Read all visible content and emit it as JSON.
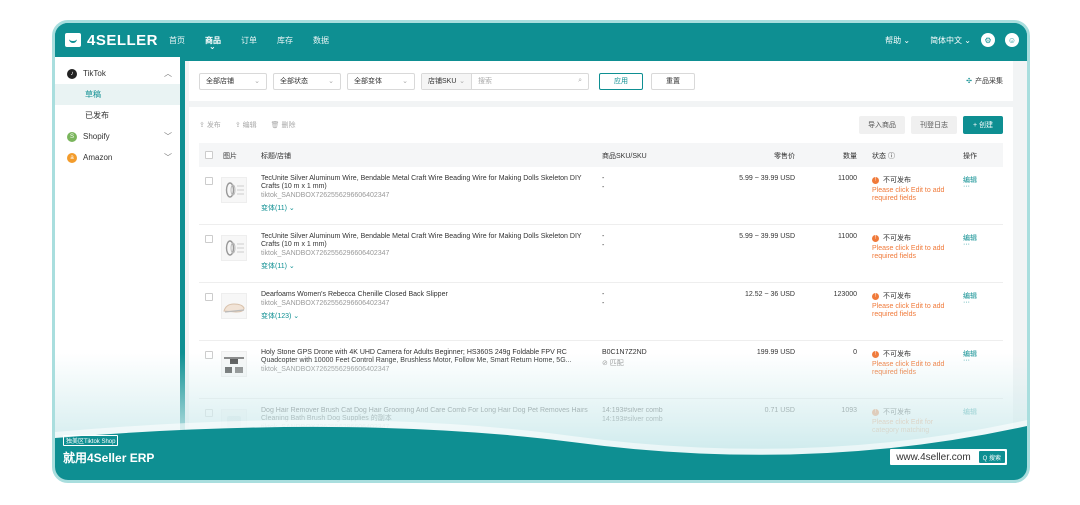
{
  "brand": {
    "name": "4SELLER"
  },
  "topnav": {
    "items": [
      "首页",
      "商品",
      "订单",
      "库存",
      "数据"
    ],
    "active_index": 1,
    "help": "帮助 ⌄",
    "language": "简体中文 ⌄"
  },
  "sidebar": {
    "groups": [
      {
        "label": "TikTok",
        "icon": "tiktok-icon",
        "color": "#222222",
        "chevron": "︿"
      },
      {
        "label": "Shopify",
        "icon": "shopify-icon",
        "color": "#7ab55c",
        "chevron": "﹀"
      },
      {
        "label": "Amazon",
        "icon": "amazon-icon",
        "color": "#f39c2c",
        "chevron": "﹀"
      }
    ],
    "tiktok_subitems": [
      "草稿",
      "已发布"
    ],
    "active_subitem": "草稿"
  },
  "filters": {
    "store": "全部店铺",
    "status": "全部状态",
    "variant": "全部变体",
    "search_type": "店铺SKU",
    "search_placeholder": "搜索",
    "apply": "应用",
    "reset": "重置",
    "collect": "产品采集"
  },
  "actions": {
    "publish": "发布",
    "edit": "编辑",
    "delete": "删除",
    "import": "导入商品",
    "log": "刊登日志",
    "create": "+ 创建"
  },
  "table": {
    "headers": {
      "image": "图片",
      "title": "标题/店铺",
      "sku": "商品SKU/SKU",
      "price": "零售价",
      "qty": "数量",
      "status": "状态 ⓘ",
      "ops": "操作"
    },
    "rows": [
      {
        "title": "TecUnite Silver Aluminum Wire, Bendable Metal Craft Wire Beading Wire for Making Dolls Skeleton DIY Crafts (10 m x 1 mm)",
        "shop": "tiktok_SANDBOX7262556296606402347",
        "variant": "变体(11) ⌄",
        "sku1": "-",
        "sku2": "-",
        "price": "5.99 ~ 39.99 USD",
        "qty": "11000",
        "status": "不可发布",
        "error": "Please click Edit to add required fields",
        "edit": "编辑",
        "more": "···"
      },
      {
        "title": "TecUnite Silver Aluminum Wire, Bendable Metal Craft Wire Beading Wire for Making Dolls Skeleton DIY Crafts (10 m x 1 mm)",
        "shop": "tiktok_SANDBOX7262556296606402347",
        "variant": "变体(11) ⌄",
        "sku1": "-",
        "sku2": "-",
        "price": "5.99 ~ 39.99 USD",
        "qty": "11000",
        "status": "不可发布",
        "error": "Please click Edit to add required fields",
        "edit": "编辑",
        "more": "···"
      },
      {
        "title": "Dearfoams Women's Rebecca Chenille Closed Back Slipper",
        "shop": "tiktok_SANDBOX7262556296606402347",
        "variant": "变体(123) ⌄",
        "sku1": "-",
        "sku2": "-",
        "price": "12.52 ~ 36 USD",
        "qty": "123000",
        "status": "不可发布",
        "error": "Please click Edit to add required fields",
        "edit": "编辑",
        "more": "···"
      },
      {
        "title": "Holy Stone GPS Drone with 4K UHD Camera for Adults Beginner; HS360S 249g Foldable FPV RC Quadcopter with 10000 Feet Control Range, Brushless Motor, Follow Me, Smart Return Home, 5G...",
        "shop": "tiktok_SANDBOX7262556296606402347",
        "variant": "",
        "sku1": "B0C1N7Z2ND",
        "sku2": "⊘ 匹配",
        "price": "199.99 USD",
        "qty": "0",
        "status": "不可发布",
        "error": "Please click Edit to add required fields",
        "edit": "编辑",
        "more": "···"
      },
      {
        "title": "Dog Hair Remover Brush Cat Dog Hair Grooming And Care Comb For Long Hair Dog Pet Removes Hairs Cleaning Bath Brush Dog Supplies 的副本",
        "shop": "tiktok_SANDBOX7262556296606402347",
        "variant": "",
        "sku1": "14:193#silver comb",
        "sku2": "14:193#silver comb",
        "price": "0.71 USD",
        "qty": "1093",
        "status": "不可发布",
        "error": "Please click Edit for category matching",
        "edit": "编辑",
        "more": "···"
      }
    ]
  },
  "promo": {
    "tag": "独美区Tiktok Shop",
    "title": "就用4Seller ERP",
    "url": "www.4seller.com",
    "search": "Q 搜索"
  },
  "colors": {
    "brand": "#0e8f92",
    "error": "#f07a3a"
  }
}
